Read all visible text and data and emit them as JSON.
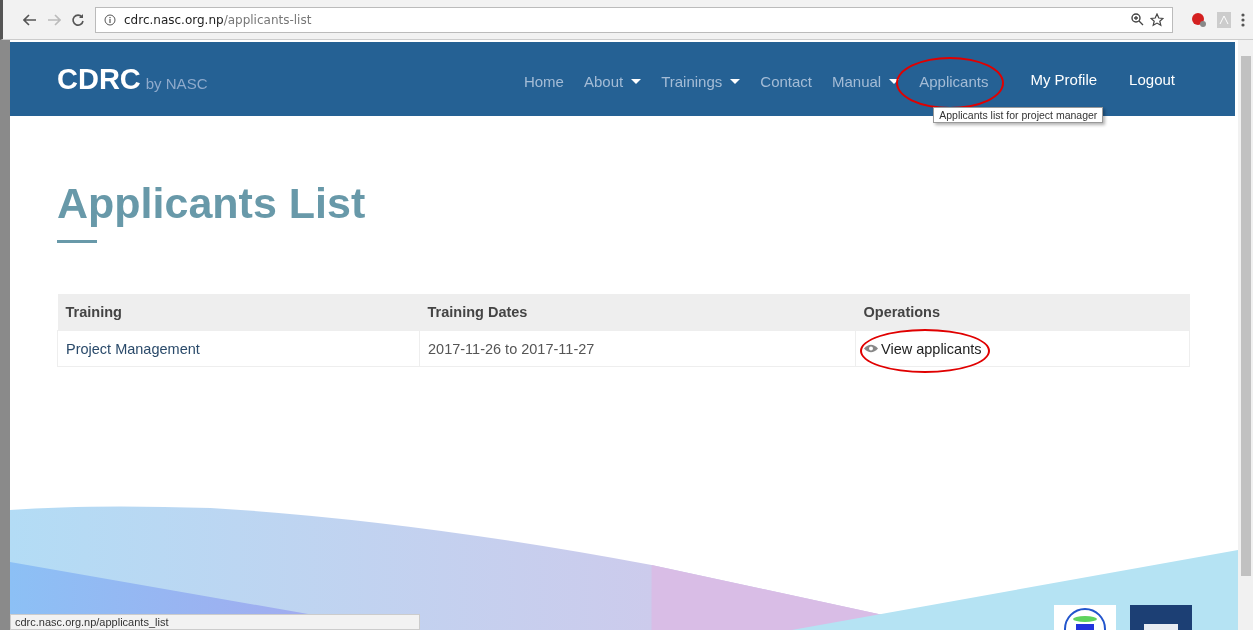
{
  "browser": {
    "url_host": "cdrc.nasc.org.np",
    "url_path": "/applicants-list",
    "status_url": "cdrc.nasc.org.np/applicants_list"
  },
  "navbar": {
    "brand": "CDRC",
    "brand_sub": "by NASC",
    "menu": [
      {
        "label": "Home",
        "dropdown": false
      },
      {
        "label": "About",
        "dropdown": true
      },
      {
        "label": "Trainings",
        "dropdown": true
      },
      {
        "label": "Contact",
        "dropdown": false
      },
      {
        "label": "Manual",
        "dropdown": true
      },
      {
        "label": "Applicants",
        "dropdown": false,
        "tooltip": "Applicants list for project manager"
      }
    ],
    "user_menu": [
      "My Profile",
      "Logout"
    ]
  },
  "page_title": "Applicants List",
  "table": {
    "columns": [
      "Training",
      "Training Dates",
      "Operations"
    ],
    "rows": [
      {
        "training": "Project Management",
        "dates": "2017-11-26 to 2017-11-27",
        "operation": "View applicants"
      }
    ]
  }
}
